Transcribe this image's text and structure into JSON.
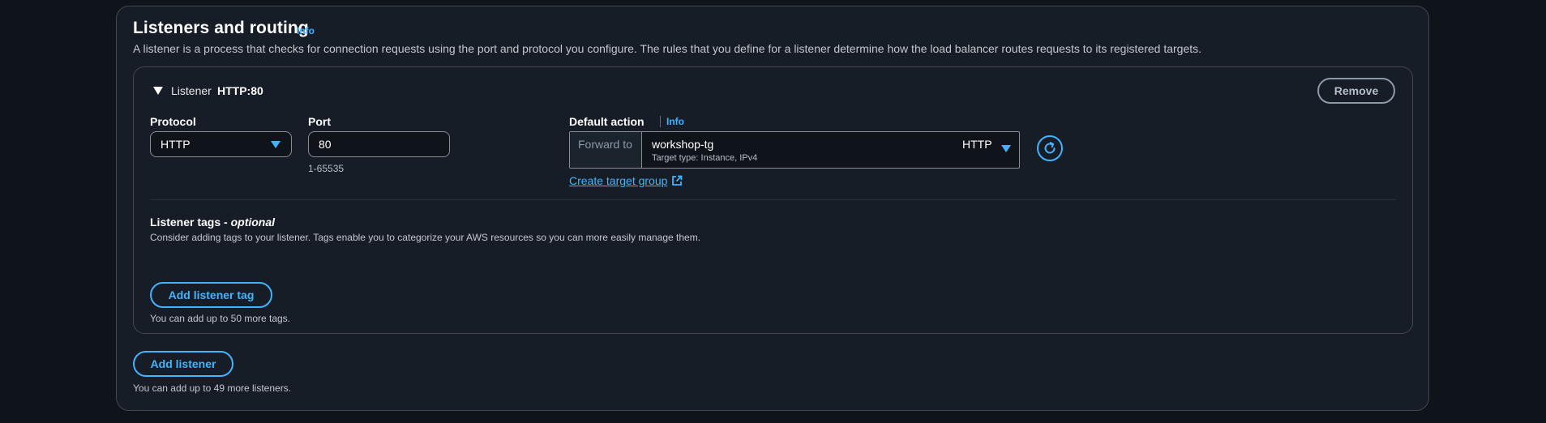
{
  "section": {
    "title": "Listeners and routing",
    "info_label": "Info",
    "description": "A listener is a process that checks for connection requests using the port and protocol you configure. The rules that you define for a listener determine how the load balancer routes requests to its registered targets."
  },
  "listener": {
    "label": "Listener",
    "value": "HTTP:80",
    "remove_label": "Remove",
    "protocol": {
      "label": "Protocol",
      "value": "HTTP"
    },
    "port": {
      "label": "Port",
      "value": "80",
      "hint": "1-65535"
    },
    "default_action": {
      "label": "Default action",
      "info_label": "Info",
      "prefix": "Forward to",
      "target_name": "workshop-tg",
      "target_detail": "Target type: Instance, IPv4",
      "target_protocol": "HTTP",
      "create_link": "Create target group"
    },
    "tags": {
      "title": "Listener tags - ",
      "title_optional": "optional",
      "description": "Consider adding tags to your listener. Tags enable you to categorize your AWS resources so you can more easily manage them.",
      "add_label": "Add listener tag",
      "hint": "You can add up to 50 more tags."
    }
  },
  "add_listener": {
    "label": "Add listener",
    "hint": "You can add up to 49 more listeners."
  },
  "colors": {
    "accent": "#42b4ff",
    "background": "#161d26",
    "border": "#424650"
  }
}
